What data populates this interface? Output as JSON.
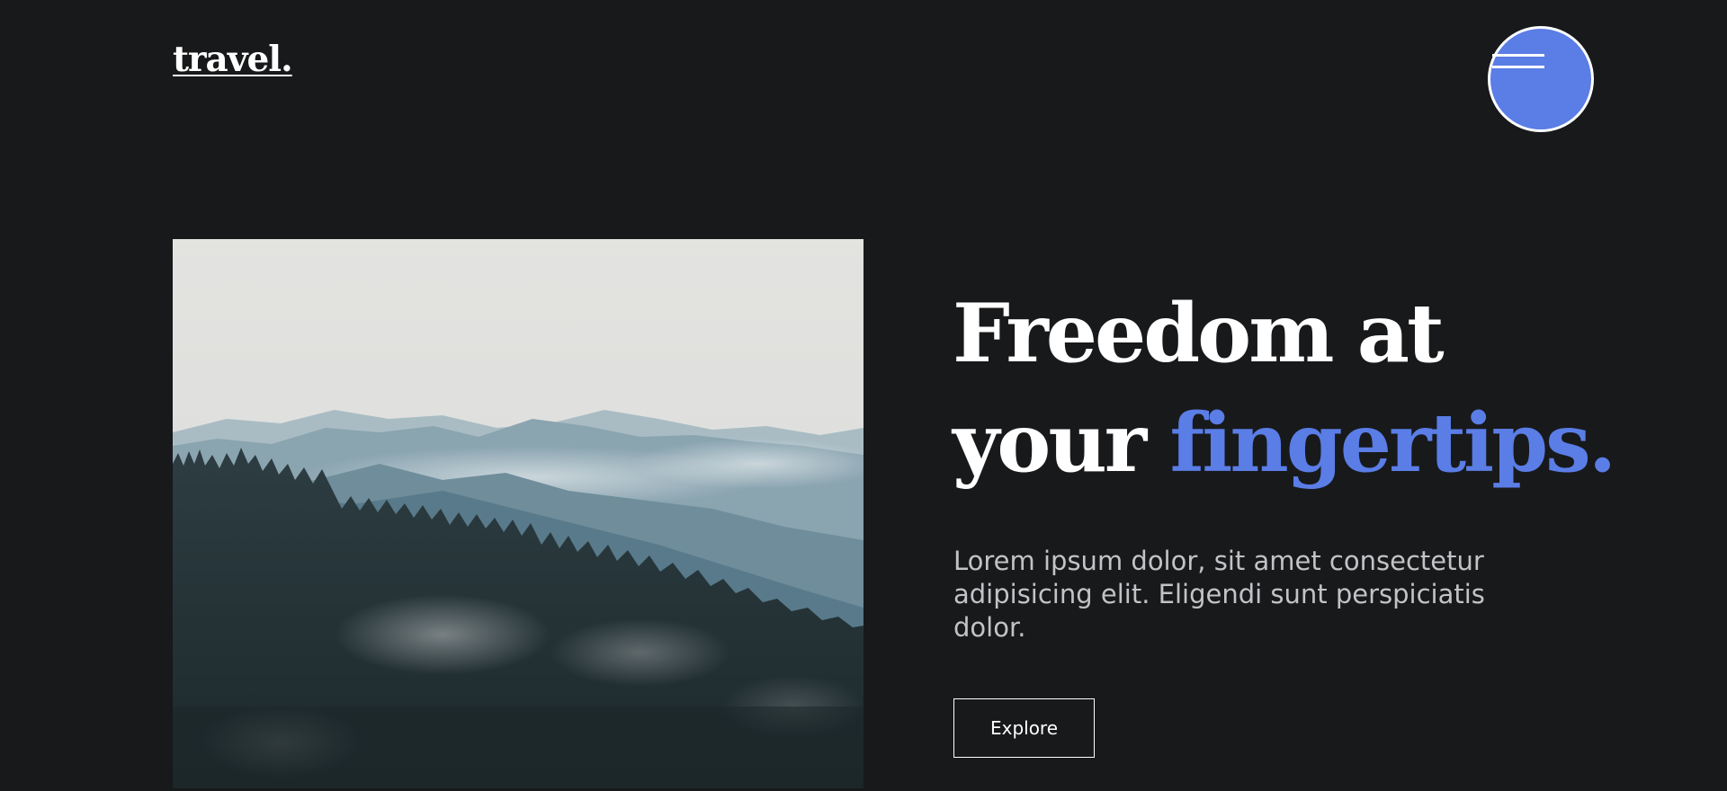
{
  "header": {
    "logo_text": "travel.",
    "menu_icon": "hamburger-menu-icon"
  },
  "hero": {
    "headline_line1": "Freedom at",
    "headline_line2_prefix": "your ",
    "headline_accent": "fingertips.",
    "description": "Lorem ipsum dolor, sit amet consectetur adipisicing elit. Eligendi sunt perspiciatis dolor.",
    "cta_label": "Explore"
  },
  "colors": {
    "background": "#18191b",
    "accent": "#5a7de6",
    "text_primary": "#ffffff",
    "text_secondary": "#c2c3c6"
  }
}
